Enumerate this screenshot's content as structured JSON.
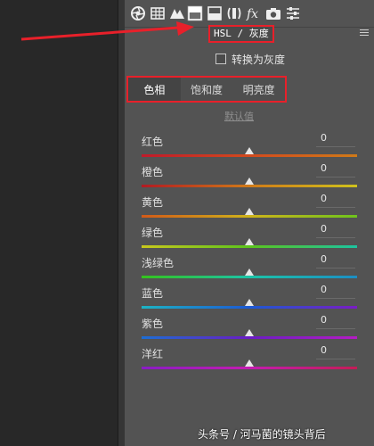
{
  "panel": {
    "title": "HSL / 灰度",
    "convert_gray_label": "转换为灰度",
    "tabs": [
      {
        "label": "色相",
        "active": true
      },
      {
        "label": "饱和度",
        "active": false
      },
      {
        "label": "明亮度",
        "active": false
      }
    ],
    "default_link": "默认值"
  },
  "toolbar": {
    "icons": [
      "aperture-icon",
      "grid-icon",
      "mountains-icon",
      "split-panel-icon",
      "split-toning-icon",
      "lens-icon",
      "fx-icon",
      "camera-icon",
      "sliders-icon"
    ],
    "active": "split-panel-icon"
  },
  "sliders": [
    {
      "label": "红色",
      "value": "0",
      "gradient": [
        "#c01a2a",
        "#d24a1e",
        "#d07a18"
      ]
    },
    {
      "label": "橙色",
      "value": "0",
      "gradient": [
        "#b21a22",
        "#d07a18",
        "#cfc21c"
      ]
    },
    {
      "label": "黄色",
      "value": "0",
      "gradient": [
        "#d25a18",
        "#cfb31a",
        "#6ec41c"
      ]
    },
    {
      "label": "绿色",
      "value": "0",
      "gradient": [
        "#c8c81c",
        "#5cc41c",
        "#1cc4a0"
      ]
    },
    {
      "label": "浅绿色",
      "value": "0",
      "gradient": [
        "#34c41c",
        "#1cc4a8",
        "#1c8ec4"
      ]
    },
    {
      "label": "蓝色",
      "value": "0",
      "gradient": [
        "#1cb4c4",
        "#1c5ad4",
        "#7a1cc4"
      ]
    },
    {
      "label": "紫色",
      "value": "0",
      "gradient": [
        "#1c6ed4",
        "#6a1cc4",
        "#b41cc4"
      ]
    },
    {
      "label": "洋红",
      "value": "0",
      "gradient": [
        "#8a1cc4",
        "#c41cb0",
        "#c41c56"
      ]
    }
  ],
  "watermark": "头条号 / 河马菌的镜头背后"
}
